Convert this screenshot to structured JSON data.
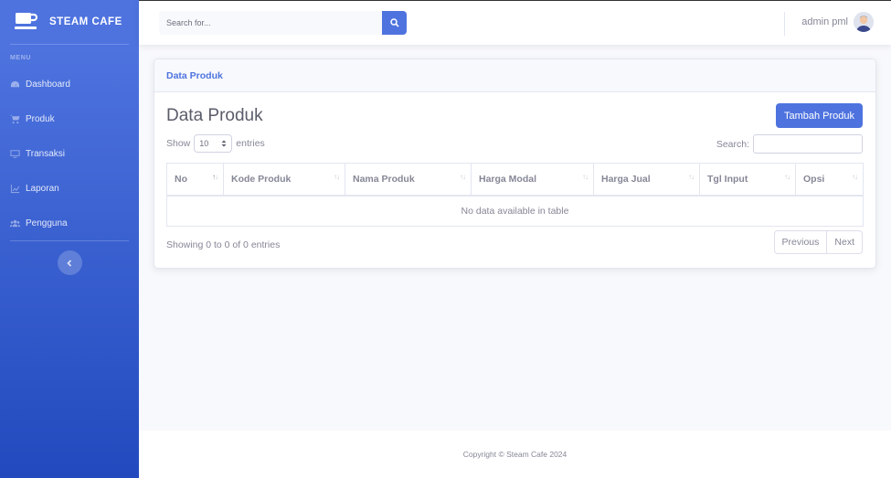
{
  "sidebar": {
    "brand": "STEAM CAFE",
    "menu_heading": "MENU",
    "items": [
      {
        "label": "Dashboard",
        "icon": "dashboard-icon"
      },
      {
        "label": "Produk",
        "icon": "cart-icon"
      },
      {
        "label": "Transaksi",
        "icon": "desktop-icon"
      },
      {
        "label": "Laporan",
        "icon": "chart-icon"
      },
      {
        "label": "Pengguna",
        "icon": "users-icon"
      }
    ],
    "toggle_icon": "chevron-left-icon"
  },
  "topbar": {
    "search_placeholder": "Search for...",
    "search_icon": "search-icon",
    "user_name": "admin pml"
  },
  "card": {
    "header_title": "Data Produk",
    "page_title": "Data Produk",
    "add_button": "Tambah Produk",
    "show_label": "Show",
    "entries_value": "10",
    "entries_label": "entries",
    "search_label": "Search:",
    "table": {
      "columns": [
        "No",
        "Kode Produk",
        "Nama Produk",
        "Harga Modal",
        "Harga Jual",
        "Tgl Input",
        "Opsi"
      ],
      "empty_message": "No data available in table"
    },
    "info": "Showing 0 to 0 of 0 entries",
    "pagination": {
      "previous": "Previous",
      "next": "Next"
    }
  },
  "footer": {
    "text": "Copyright © Steam Cafe 2024"
  },
  "colors": {
    "primary": "#4e73df",
    "sidebar_dark": "#224abe",
    "text": "#858796"
  }
}
